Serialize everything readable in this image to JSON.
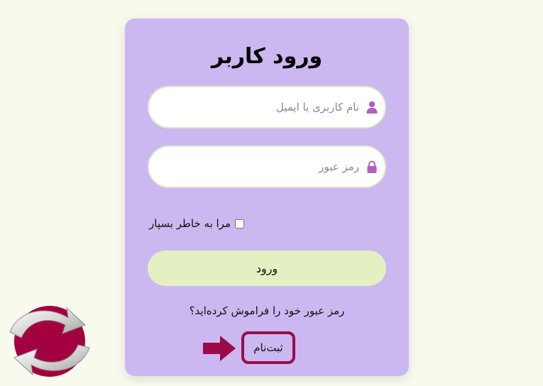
{
  "login": {
    "title": "ورود کاربر",
    "username_placeholder": "نام کاربری یا ایمیل",
    "password_placeholder": "رمز عبور",
    "remember_label": "مرا به خاطر بسپار",
    "remember_checked": false,
    "submit_label": "ورود",
    "forgot_link": "رمز عبور خود را فراموش کرده‌اید؟",
    "register_link": "ثبت‌نام"
  },
  "icons": {
    "username": "user-icon",
    "password": "lock-icon",
    "pointer": "right-arrow-icon",
    "logo": "refresh-arrows-logo"
  },
  "colors": {
    "background": "#f9faee",
    "card": "#cbb8f0",
    "accent_icon": "#b25fc2",
    "button": "#e4f0c2",
    "highlight": "#9b0b4a"
  }
}
